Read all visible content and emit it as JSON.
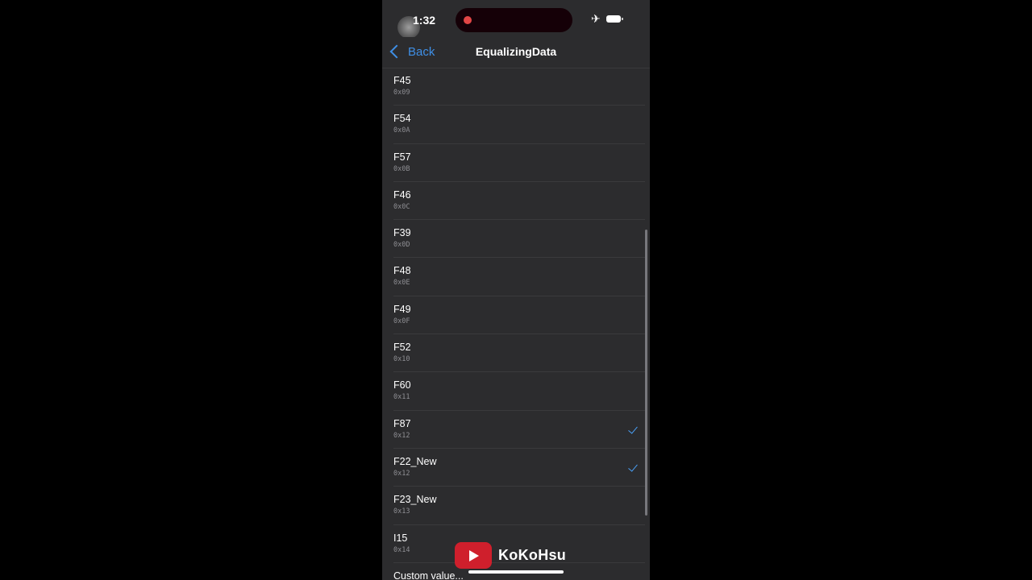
{
  "status_bar": {
    "time": "1:32",
    "icons": [
      "touch-indicator",
      "recording-dot",
      "airplane-icon",
      "battery-icon"
    ]
  },
  "nav": {
    "back_label": "Back",
    "title": "EqualizingData"
  },
  "items": [
    {
      "title": "F45",
      "code": "0x09",
      "checked": false
    },
    {
      "title": "F54",
      "code": "0x0A",
      "checked": false
    },
    {
      "title": "F57",
      "code": "0x0B",
      "checked": false
    },
    {
      "title": "F46",
      "code": "0x0C",
      "checked": false
    },
    {
      "title": "F39",
      "code": "0x0D",
      "checked": false
    },
    {
      "title": "F48",
      "code": "0x0E",
      "checked": false
    },
    {
      "title": "F49",
      "code": "0x0F",
      "checked": false
    },
    {
      "title": "F52",
      "code": "0x10",
      "checked": false
    },
    {
      "title": "F60",
      "code": "0x11",
      "checked": false
    },
    {
      "title": "F87",
      "code": "0x12",
      "checked": true
    },
    {
      "title": "F22_New",
      "code": "0x12",
      "checked": true
    },
    {
      "title": "F23_New",
      "code": "0x13",
      "checked": false
    },
    {
      "title": "I15",
      "code": "0x14",
      "checked": false
    }
  ],
  "custom_value_label": "Custom value...",
  "watermark": {
    "text": "KoKoHsu"
  },
  "colors": {
    "accent": "#3f8fe6",
    "check": "#4a9ff5",
    "background": "#2c2c2e",
    "record": "#e24646",
    "youtube": "#cf1f2c"
  }
}
